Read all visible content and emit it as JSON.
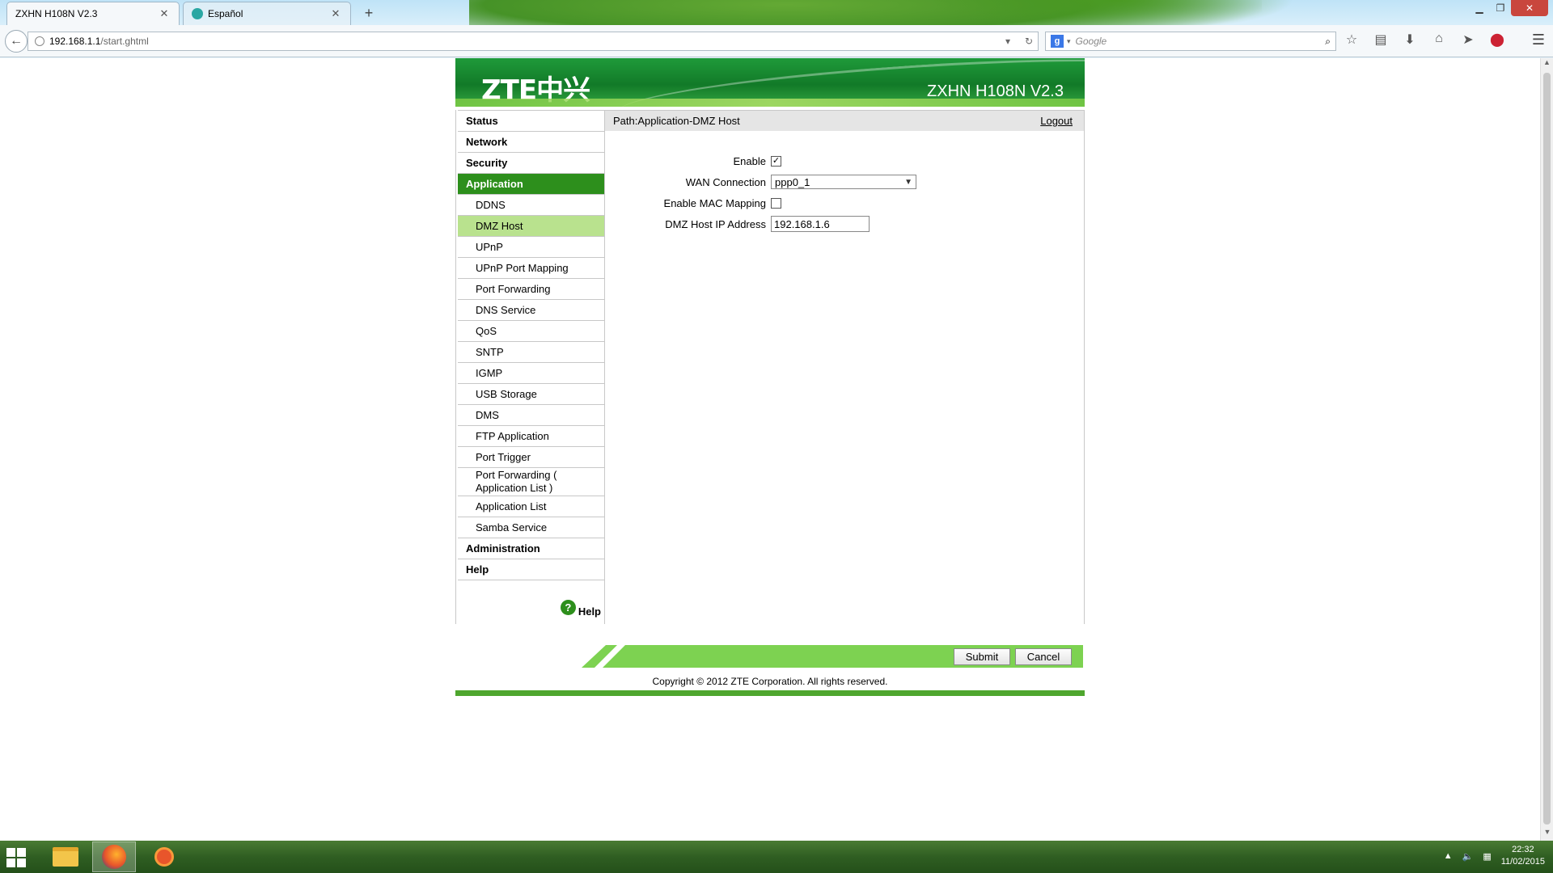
{
  "browser": {
    "tabs": [
      {
        "label": "ZXHN H108N V2.3",
        "active": true
      },
      {
        "label": "Español",
        "active": false
      }
    ],
    "url_host": "192.168.1.1",
    "url_path": "/start.ghtml",
    "search_placeholder": "Google",
    "search_engine_icon": "google-icon"
  },
  "router": {
    "logo": "ZTE中兴",
    "model": "ZXHN H108N V2.3",
    "path": "Path:Application-DMZ Host",
    "logout": "Logout",
    "menu": {
      "status": "Status",
      "network": "Network",
      "security": "Security",
      "application": "Application",
      "administration": "Administration",
      "help": "Help"
    },
    "submenu": [
      "DDNS",
      "DMZ Host",
      "UPnP",
      "UPnP Port Mapping",
      "Port Forwarding",
      "DNS Service",
      "QoS",
      "SNTP",
      "IGMP",
      "USB Storage",
      "DMS",
      "FTP Application",
      "Port Trigger",
      "Port Forwarding ( Application List )",
      "Application List",
      "Samba Service"
    ],
    "active_submenu": "DMZ Host",
    "side_help": "Help",
    "form": {
      "enable_label": "Enable",
      "enable_checked": true,
      "wan_label": "WAN Connection",
      "wan_value": "ppp0_1",
      "mac_label": "Enable MAC Mapping",
      "mac_checked": false,
      "ip_label": "DMZ Host IP Address",
      "ip_value": "192.168.1.6"
    },
    "submit": "Submit",
    "cancel": "Cancel",
    "copyright": "Copyright © 2012 ZTE Corporation. All rights reserved."
  },
  "taskbar": {
    "time": "22:32",
    "date": "11/02/2015"
  },
  "colors": {
    "menu_active": "#2d8f1c",
    "submenu_active": "#b9e28e",
    "action_bar": "#7dd251"
  }
}
